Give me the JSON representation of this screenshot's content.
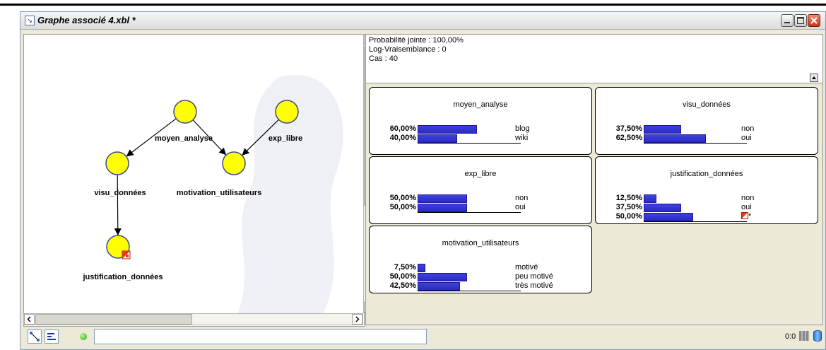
{
  "window": {
    "title": "Graphe associé 4.xbl *"
  },
  "graph": {
    "nodes": [
      {
        "id": "moyen_analyse",
        "label": "moyen_analyse"
      },
      {
        "id": "exp_libre",
        "label": "exp_libre"
      },
      {
        "id": "visu_donnees",
        "label": "visu_données"
      },
      {
        "id": "motivation_utilisateurs",
        "label": "motivation_utilisateurs"
      },
      {
        "id": "justification_donnees",
        "label": "justification_données",
        "has_evidence": true
      }
    ],
    "edges": [
      [
        "moyen_analyse",
        "visu_donnees"
      ],
      [
        "moyen_analyse",
        "motivation_utilisateurs"
      ],
      [
        "exp_libre",
        "motivation_utilisateurs"
      ],
      [
        "visu_donnees",
        "justification_donnees"
      ]
    ]
  },
  "summary": {
    "joint": "Probabilité jointe : 100,00%",
    "loglik": "Log-Vraisemblance : 0",
    "cases": "Cas : 40"
  },
  "monitors": [
    {
      "title": "moyen_analyse",
      "rows": [
        {
          "value": "60,00%",
          "fraction": 0.6,
          "label": "blog"
        },
        {
          "value": "40,00%",
          "fraction": 0.4,
          "label": "wiki"
        }
      ]
    },
    {
      "title": "visu_données",
      "rows": [
        {
          "value": "37,50%",
          "fraction": 0.375,
          "label": "non"
        },
        {
          "value": "62,50%",
          "fraction": 0.625,
          "label": "oui"
        }
      ]
    },
    {
      "title": "exp_libre",
      "rows": [
        {
          "value": "50,00%",
          "fraction": 0.5,
          "label": "non"
        },
        {
          "value": "50,00%",
          "fraction": 0.5,
          "label": "oui"
        }
      ]
    },
    {
      "title": "justification_données",
      "rows": [
        {
          "value": "12,50%",
          "fraction": 0.125,
          "label": "non"
        },
        {
          "value": "37,50%",
          "fraction": 0.375,
          "label": "oui"
        },
        {
          "value": "50,00%",
          "fraction": 0.5,
          "label": "*",
          "evidence_icon": true
        }
      ]
    },
    {
      "title": "motivation_utilisateurs",
      "rows": [
        {
          "value": "7,50%",
          "fraction": 0.075,
          "label": "motivé"
        },
        {
          "value": "50,00%",
          "fraction": 0.5,
          "label": "peu motivé"
        },
        {
          "value": "42,50%",
          "fraction": 0.425,
          "label": "très motivé"
        }
      ]
    }
  ],
  "statusbar": {
    "coord": "0:0",
    "input_value": ""
  },
  "colors": {
    "node_fill": "#ffff00",
    "node_stroke": "#3a4a8a",
    "bar": "#3a3ad8"
  }
}
